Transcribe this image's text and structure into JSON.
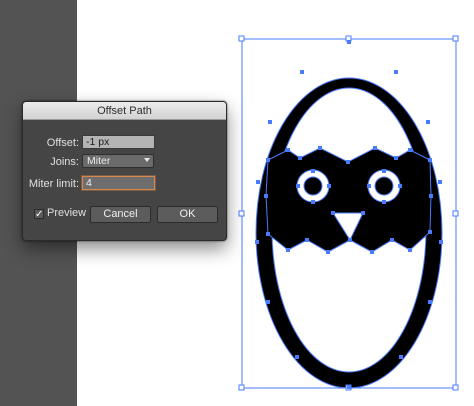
{
  "dialog": {
    "title": "Offset Path",
    "offset_label": "Offset:",
    "offset_value": "-1 px",
    "joins_label": "Joins:",
    "joins_value": "Miter",
    "miter_label": "Miter limit:",
    "miter_value": "4",
    "preview_label": "Preview",
    "preview_checked": true,
    "cancel_label": "Cancel",
    "ok_label": "OK"
  },
  "colors": {
    "selection_blue": "#4a7bff",
    "artwork_fill": "#000000",
    "panel_gray": "#535353"
  },
  "artwork": {
    "subject": "chick-hatching-egg",
    "icon": "chick-in-egg-icon"
  }
}
